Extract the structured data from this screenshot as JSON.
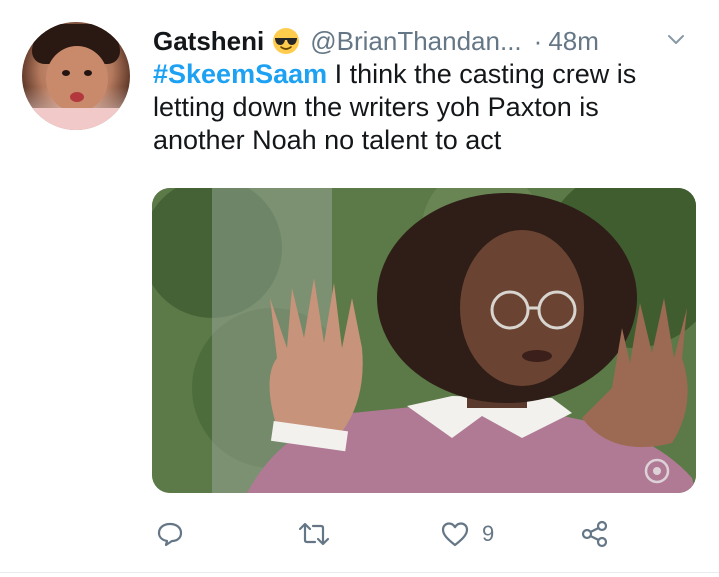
{
  "tweet": {
    "display_name": "Gatsheni",
    "handle": "@BrianThandan...",
    "separator": "·",
    "time": "48m",
    "hashtag": "#SkeemSaam",
    "body": " I think the casting crew is letting down the writers yoh Paxton is another Noah no talent to act",
    "name_emoji": "smiling-face-with-sunglasses",
    "media_description_icon": "photo-media"
  },
  "actions": {
    "reply_icon": "reply-icon",
    "retweet_icon": "retweet-icon",
    "like_icon": "like-icon",
    "like_count": "9",
    "share_icon": "share-icon"
  },
  "colors": {
    "text": "#14171a",
    "secondary": "#657786",
    "link": "#1da1f2"
  }
}
